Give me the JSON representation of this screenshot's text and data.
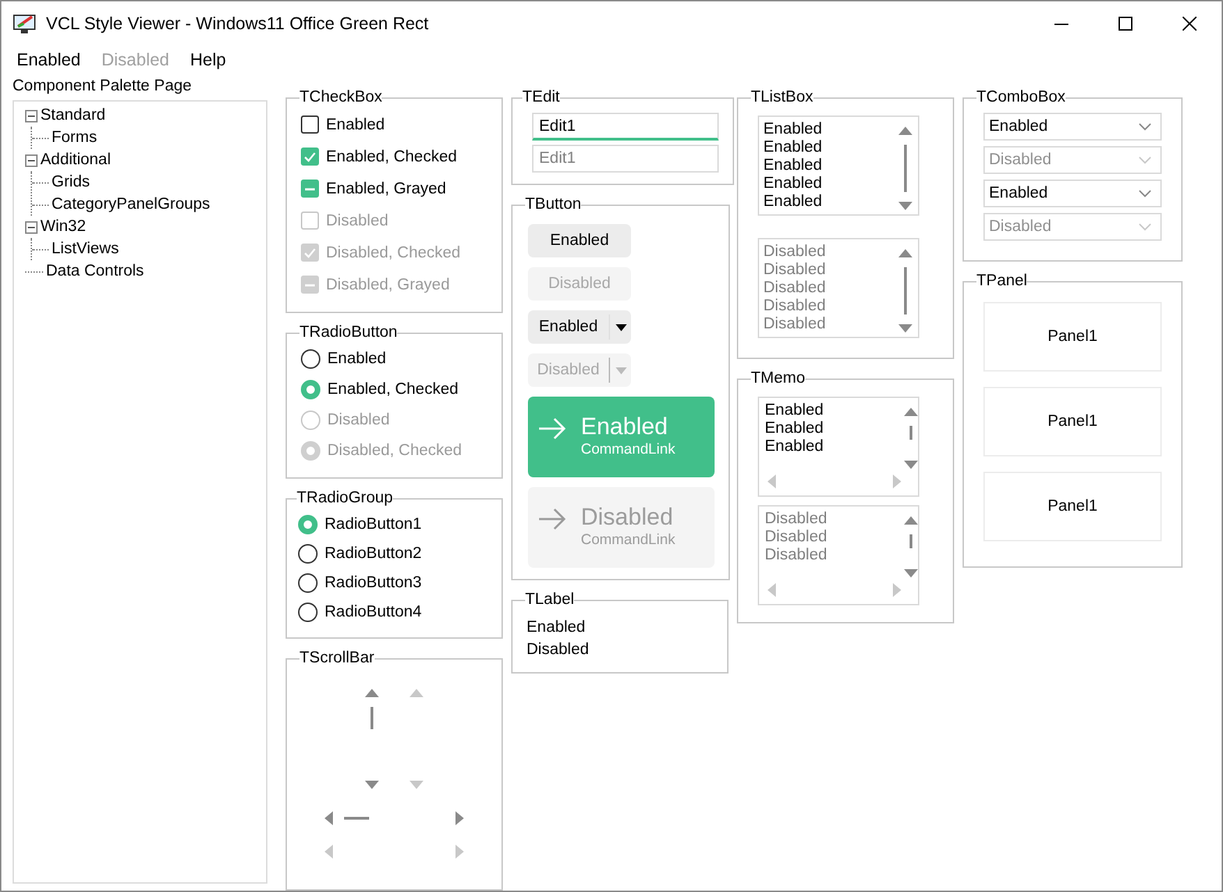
{
  "window": {
    "title": "VCL Style Viewer - Windows11 Office Green Rect"
  },
  "menu": [
    {
      "label": "Enabled",
      "disabled": false
    },
    {
      "label": "Disabled",
      "disabled": true
    },
    {
      "label": "Help",
      "disabled": false
    }
  ],
  "palette": {
    "label": "Component Palette Page",
    "tree": [
      {
        "label": "Standard",
        "expanded": true,
        "children": [
          {
            "label": "Forms"
          }
        ]
      },
      {
        "label": "Additional",
        "expanded": true,
        "children": [
          {
            "label": "Grids"
          },
          {
            "label": "CategoryPanelGroups"
          }
        ]
      },
      {
        "label": "Win32",
        "expanded": true,
        "children": [
          {
            "label": "ListViews"
          }
        ]
      },
      {
        "label": "Data Controls"
      }
    ]
  },
  "checkbox": {
    "title": "TCheckBox",
    "items": [
      {
        "label": "Enabled",
        "checked": false,
        "indeterminate": false,
        "disabled": false
      },
      {
        "label": "Enabled, Checked",
        "checked": true,
        "indeterminate": false,
        "disabled": false
      },
      {
        "label": "Enabled, Grayed",
        "checked": false,
        "indeterminate": true,
        "disabled": false
      },
      {
        "label": "Disabled",
        "checked": false,
        "indeterminate": false,
        "disabled": true
      },
      {
        "label": "Disabled, Checked",
        "checked": true,
        "indeterminate": false,
        "disabled": true
      },
      {
        "label": "Disabled, Grayed",
        "checked": false,
        "indeterminate": true,
        "disabled": true
      }
    ]
  },
  "radiobutton": {
    "title": "TRadioButton",
    "items": [
      {
        "label": "Enabled",
        "selected": false,
        "disabled": false
      },
      {
        "label": "Enabled, Checked",
        "selected": true,
        "disabled": false
      },
      {
        "label": "Disabled",
        "selected": false,
        "disabled": true
      },
      {
        "label": "Disabled, Checked",
        "selected": true,
        "disabled": true
      }
    ]
  },
  "radiogroup": {
    "title": "TRadioGroup",
    "items": [
      {
        "label": "RadioButton1",
        "selected": true
      },
      {
        "label": "RadioButton2",
        "selected": false
      },
      {
        "label": "RadioButton3",
        "selected": false
      },
      {
        "label": "RadioButton4",
        "selected": false
      }
    ]
  },
  "scrollbar": {
    "title": "TScrollBar"
  },
  "edit": {
    "title": "TEdit",
    "fields": [
      {
        "value": "Edit1",
        "disabled": false
      },
      {
        "value": "Edit1",
        "disabled": true
      }
    ]
  },
  "button": {
    "title": "TButton",
    "items": [
      {
        "kind": "push",
        "label": "Enabled",
        "disabled": false
      },
      {
        "kind": "push",
        "label": "Disabled",
        "disabled": true
      },
      {
        "kind": "split",
        "label": "Enabled",
        "disabled": false
      },
      {
        "kind": "split",
        "label": "Disabled",
        "disabled": true
      },
      {
        "kind": "commandlink",
        "label": "Enabled",
        "note": "CommandLink",
        "disabled": false
      },
      {
        "kind": "commandlink",
        "label": "Disabled",
        "note": "CommandLink",
        "disabled": true
      }
    ]
  },
  "label": {
    "title": "TLabel",
    "lines": [
      "Enabled",
      "Disabled"
    ]
  },
  "listbox": {
    "title": "TListBox",
    "lists": [
      {
        "disabled": false,
        "items": [
          "Enabled",
          "Enabled",
          "Enabled",
          "Enabled",
          "Enabled"
        ]
      },
      {
        "disabled": true,
        "items": [
          "Disabled",
          "Disabled",
          "Disabled",
          "Disabled",
          "Disabled"
        ]
      }
    ]
  },
  "memo": {
    "title": "TMemo",
    "memos": [
      {
        "disabled": false,
        "lines": [
          "Enabled",
          "Enabled",
          "Enabled"
        ]
      },
      {
        "disabled": true,
        "lines": [
          "Disabled",
          "Disabled",
          "Disabled"
        ]
      }
    ]
  },
  "combobox": {
    "title": "TComboBox",
    "items": [
      {
        "value": "Enabled",
        "disabled": false
      },
      {
        "value": "Disabled",
        "disabled": true
      },
      {
        "value": "Enabled",
        "disabled": false
      },
      {
        "value": "Disabled",
        "disabled": true
      }
    ]
  },
  "panel": {
    "title": "TPanel",
    "items": [
      "Panel1",
      "Panel1",
      "Panel1"
    ]
  }
}
